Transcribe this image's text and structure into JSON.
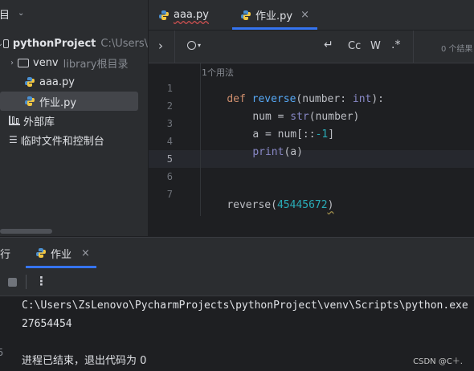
{
  "project_panel": {
    "header_label": "项目",
    "tree": [
      {
        "label": "pythonProject",
        "hint": "C:\\Users\\"
      },
      {
        "label": "venv",
        "hint": "library根目录"
      },
      {
        "label": "aaa.py"
      },
      {
        "label": "作业.py"
      },
      {
        "label": "外部库"
      },
      {
        "label": "临时文件和控制台"
      }
    ]
  },
  "editor": {
    "tabs": [
      {
        "label": "aaa.py"
      },
      {
        "label": "作业.py",
        "close": "×"
      }
    ],
    "find": {
      "case_label": "Cc",
      "word_label": "W",
      "regex_label": ".*",
      "results": "0 个结果"
    },
    "usages_hint": "1个用法",
    "line_numbers": [
      "1",
      "2",
      "3",
      "4",
      "5",
      "6",
      "7"
    ],
    "code": {
      "l1_def": "def",
      "l1_name": "reverse",
      "l1_open": "(",
      "l1_param": "number",
      "l1_colon": ": ",
      "l1_type": "int",
      "l1_close": "):",
      "l2_var": "num",
      "l2_eq": " = ",
      "l2_fn": "str",
      "l2_arg": "(number)",
      "l3_var": "a",
      "l3_eq": " = ",
      "l3_obj": "num[::",
      "l3_num": "-1",
      "l3_end": "]",
      "l4_fn": "print",
      "l4_arg": "(a)",
      "l7_fn": "reverse",
      "l7_open": "(",
      "l7_num": "45445672",
      "l7_close": ")"
    }
  },
  "run_panel": {
    "run_label": "运行",
    "tab_label": "作业",
    "tab_close": "×",
    "console": [
      "C:\\Users\\ZsLenovo\\PycharmProjects\\pythonProject\\venv\\Scripts\\python.exe",
      "27654454",
      "",
      "进程已结束，退出代码为 0"
    ],
    "gutter_hint": "5"
  },
  "watermark": "CSDN @C＋."
}
